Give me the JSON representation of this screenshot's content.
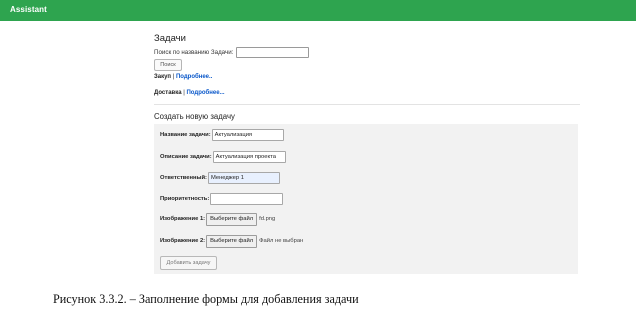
{
  "app": {
    "brand": "Assistant"
  },
  "tasks_page": {
    "title": "Задачи",
    "search": {
      "label": "Поиск по названию Задачи:",
      "value": "",
      "button_label": "Поиск"
    },
    "task_list": [
      {
        "name": "Закуп",
        "separator": " | ",
        "link": "Подробнее.."
      },
      {
        "name": "Доставка",
        "separator": " | ",
        "link": "Подробнее..."
      }
    ]
  },
  "create_form": {
    "title": "Создать новую задачу",
    "fields": {
      "name": {
        "label": "Название задачи:",
        "value": "Актуализация"
      },
      "description": {
        "label": "Описание задачи:",
        "value": "Актуализация проекта"
      },
      "responsible": {
        "label": "Ответственный:",
        "value": "Менеджер 1"
      },
      "priority": {
        "label": "Приоритетность:",
        "value": ""
      },
      "image1": {
        "label": "Изображение 1:",
        "button_label": "Выберите файл",
        "status": "fd.png"
      },
      "image2": {
        "label": "Изображение 2:",
        "button_label": "Выберите файл",
        "status": "Файл не выбран"
      }
    },
    "submit_label": "Добавить задачу"
  },
  "caption": "Рисунок 3.3.2. – Заполнение формы для добавления задачи",
  "colors": {
    "navbar": "#2ea44f",
    "link": "#0a58ca",
    "form_bg": "#f2f2f2",
    "autofill_bg": "#e8f0fe"
  }
}
